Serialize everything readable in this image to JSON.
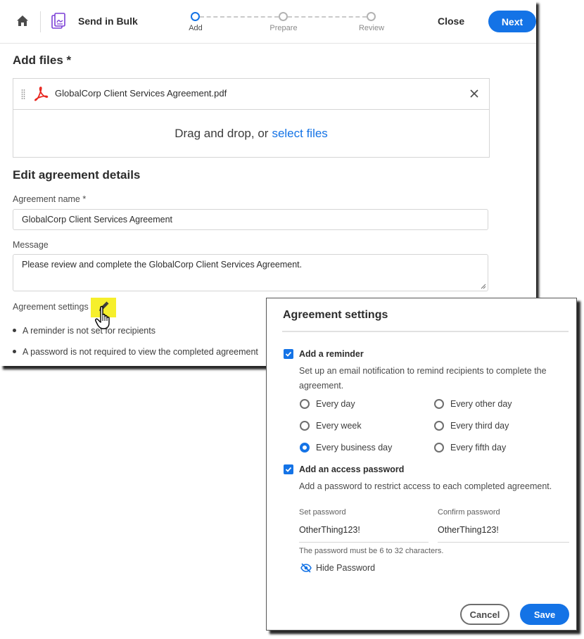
{
  "header": {
    "title": "Send in Bulk",
    "steps": [
      {
        "label": "Add",
        "active": true
      },
      {
        "label": "Prepare",
        "active": false
      },
      {
        "label": "Review",
        "active": false
      }
    ],
    "close_label": "Close",
    "next_label": "Next"
  },
  "add_files": {
    "title": "Add files *",
    "file_name": "GlobalCorp Client Services Agreement.pdf",
    "drop_text": "Drag and drop, or",
    "drop_link": "select files"
  },
  "details": {
    "title": "Edit agreement details",
    "name_label": "Agreement name *",
    "name_value": "GlobalCorp Client Services Agreement",
    "message_label": "Message",
    "message_value": "Please review and complete the GlobalCorp Client Services Agreement.",
    "settings_label": "Agreement settings",
    "bullets": [
      "A reminder is not set for recipients",
      "A password is not required to view the completed agreement"
    ]
  },
  "dialog": {
    "title": "Agreement settings",
    "reminder": {
      "checked": true,
      "label": "Add a reminder",
      "description_line1": "Set up an email notification to remind recipients to complete the",
      "description_line2": "agreement.",
      "options": [
        {
          "label": "Every day",
          "selected": false
        },
        {
          "label": "Every other day",
          "selected": false
        },
        {
          "label": "Every week",
          "selected": false
        },
        {
          "label": "Every third day",
          "selected": false
        },
        {
          "label": "Every business day",
          "selected": true
        },
        {
          "label": "Every fifth day",
          "selected": false
        }
      ]
    },
    "password": {
      "checked": true,
      "label": "Add an access password",
      "description": "Add a password to restrict access to each completed agreement.",
      "set_label": "Set password",
      "set_value": "OtherThing123!",
      "confirm_label": "Confirm password",
      "confirm_value": "OtherThing123!",
      "hint": "The password must be 6 to 32 characters.",
      "toggle_label": "Hide Password"
    },
    "cancel_label": "Cancel",
    "save_label": "Save"
  },
  "colors": {
    "accent": "#1473e6",
    "highlight": "#f6ef2c",
    "pdf_red": "#e8251e"
  }
}
